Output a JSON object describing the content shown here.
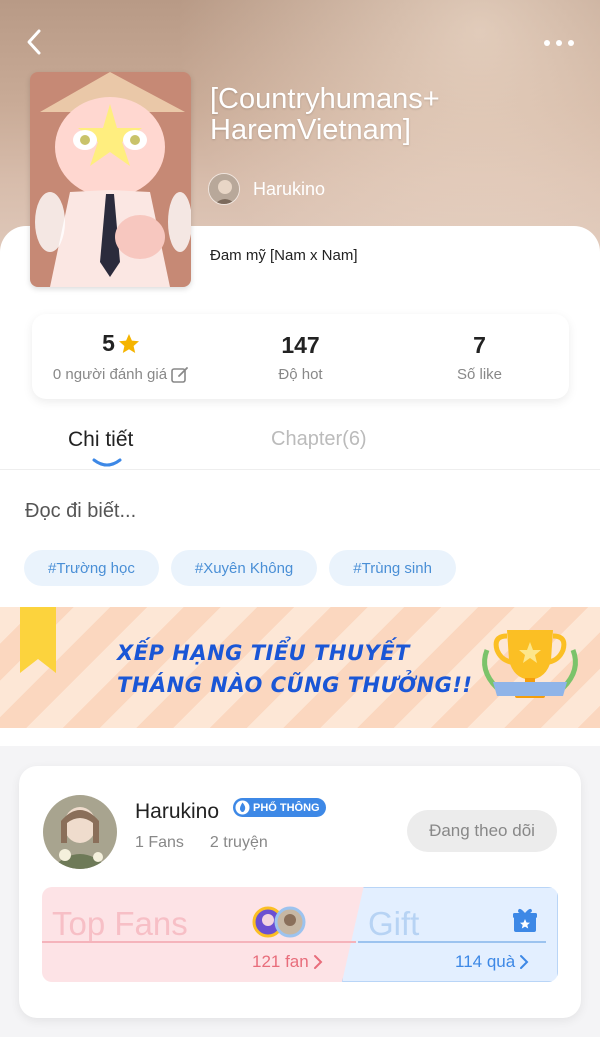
{
  "book": {
    "title": "[Countryhumans+ HaremVietnam]",
    "author": "Harukino",
    "genre": "Đam mỹ [Nam x Nam]"
  },
  "stats": {
    "rating": "5",
    "rating_label": "0 người đánh giá",
    "hot": "147",
    "hot_label": "Độ hot",
    "likes": "7",
    "likes_label": "Số like"
  },
  "tabs": {
    "detail": "Chi tiết",
    "chapters": "Chapter(6)"
  },
  "description": "Đọc đi biết...",
  "tags": [
    "#Trường học",
    "#Xuyên Không",
    "#Trùng sinh"
  ],
  "banner": {
    "line1": "XẾP HẠNG TIỂU THUYẾT",
    "line2": "THÁNG NÀO CŨNG THƯỞNG!!"
  },
  "author_card": {
    "name": "Harukino",
    "badge": "PHỔ THÔNG",
    "fans": "1 Fans",
    "stories": "2 truyện",
    "follow_label": "Đang theo dõi",
    "top_fans_title": "Top Fans",
    "fan_count": "121 fan",
    "gift_title": "Gift",
    "gift_count": "114 quà"
  },
  "icons": {
    "back": "chevron-left-icon",
    "more": "more-dots-icon",
    "star": "star-icon",
    "edit": "edit-icon",
    "gift": "gift-icon"
  },
  "colors": {
    "accent_blue": "#3d88e6",
    "star": "#f5b400",
    "tag_bg": "#eaf3fc",
    "fan_pink": "#e86d7b"
  }
}
